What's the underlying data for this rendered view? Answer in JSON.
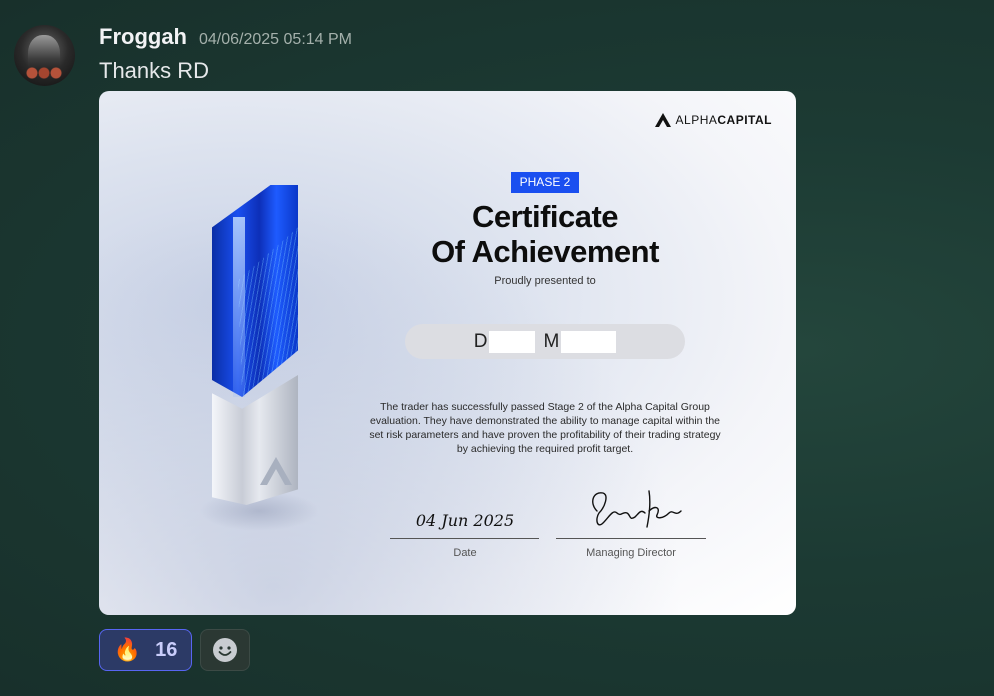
{
  "message": {
    "username": "Froggah",
    "timestamp": "04/06/2025 05:14 PM",
    "text": "Thanks RD"
  },
  "certificate": {
    "brand_light": "ALPHA",
    "brand_bold": "CAPITAL",
    "phase_badge": "PHASE 2",
    "title_line1": "Certificate",
    "title_line2": "Of Achievement",
    "presented": "Proudly presented to",
    "name_initial_first": "D",
    "name_initial_last": "M",
    "body": "The trader has successfully passed Stage 2 of the Alpha Capital Group evaluation. They have demonstrated the ability to manage capital within the set risk parameters and have proven the profitability of their trading strategy by achieving the required profit target.",
    "date_value": "04 Jun 2025",
    "date_label": "Date",
    "director_label": "Managing Director",
    "accent_color": "#1a4ff0"
  },
  "reactions": [
    {
      "emoji": "🔥",
      "count": "16",
      "active": true
    }
  ],
  "icons": {
    "add_reaction": "smiley-add-reaction-icon"
  }
}
